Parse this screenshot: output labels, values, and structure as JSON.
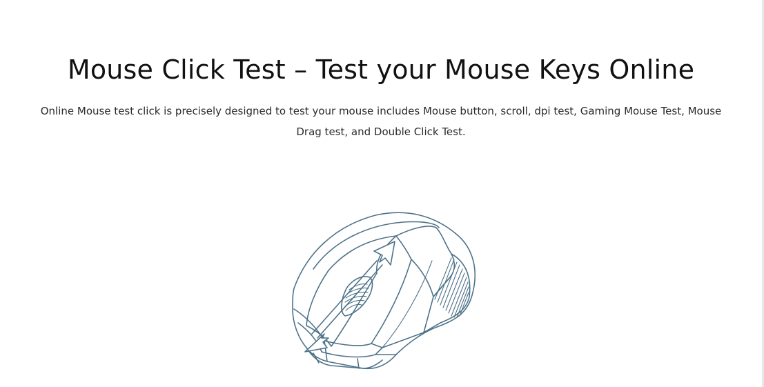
{
  "header": {
    "title": "Mouse Click Test – Test your Mouse Keys Online",
    "intro": "Online Mouse test click is precisely designed to test your mouse includes Mouse button, scroll, dpi test, Gaming Mouse Test, Mouse Drag test, and Double Click Test."
  },
  "illustration": {
    "icon": "computer-mouse-icon",
    "line_color": "#4e7289"
  }
}
